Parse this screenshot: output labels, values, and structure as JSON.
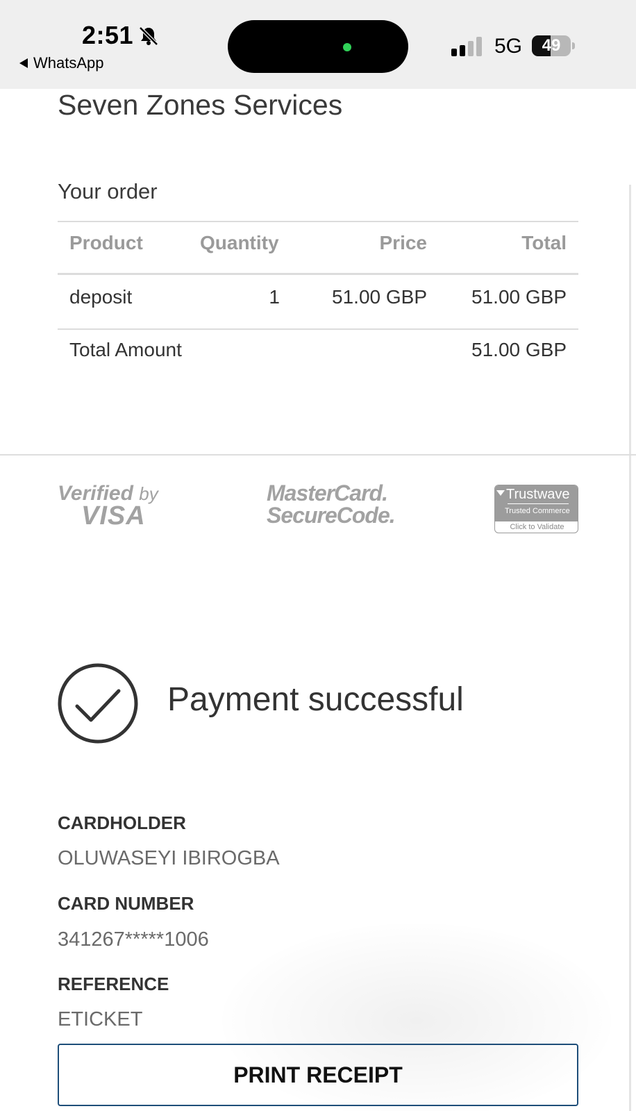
{
  "status_bar": {
    "time": "2:51",
    "back_app": "WhatsApp",
    "network": "5G",
    "battery": "49",
    "battery_level_percent": 49,
    "icons": [
      "bell-slash-icon",
      "signal-bars-icon",
      "battery-icon"
    ]
  },
  "merchant": {
    "name": "Seven Zones Services"
  },
  "order": {
    "title": "Your order",
    "headers": {
      "product": "Product",
      "quantity": "Quantity",
      "price": "Price",
      "total": "Total"
    },
    "rows": [
      {
        "product": "deposit",
        "quantity": "1",
        "price": "51.00 GBP",
        "total": "51.00 GBP"
      }
    ],
    "total_label": "Total Amount",
    "total_value": "51.00 GBP"
  },
  "security_logos": {
    "visa": {
      "line1": "Verified",
      "line1_by": "by",
      "line2": "VISA"
    },
    "mastercard": {
      "line1": "MasterCard.",
      "line2": "SecureCode."
    },
    "trustwave": {
      "name": "Trustwave",
      "sub": "Trusted Commerce",
      "validate": "Click to Validate"
    }
  },
  "payment": {
    "status_text": "Payment successful",
    "cardholder_label": "CARDHOLDER",
    "cardholder_value": "OLUWASEYI IBIROGBA",
    "card_number_label": "CARD NUMBER",
    "card_number_value": "341267*****1006",
    "reference_label": "REFERENCE",
    "reference_value": "ETICKET"
  },
  "actions": {
    "print_receipt": "PRINT RECEIPT"
  },
  "colors": {
    "status_bar_bg": "#efefef",
    "button_border": "#1e4e79",
    "island_dot": "#30d158",
    "logo_gray": "#a2a2a2"
  }
}
